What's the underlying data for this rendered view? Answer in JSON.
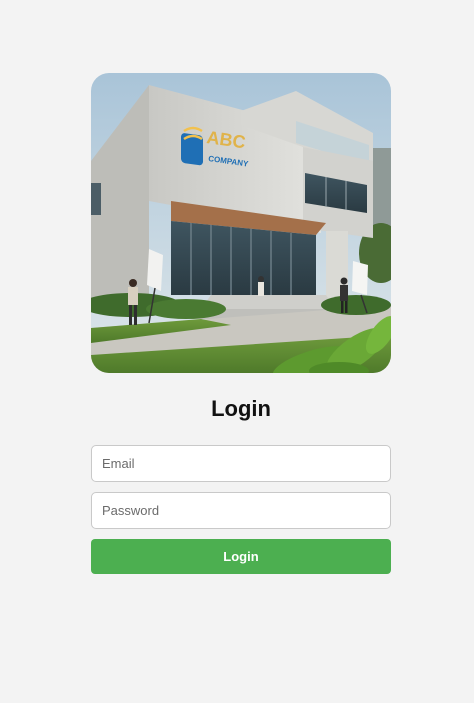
{
  "hero": {
    "logo_text": "ABC",
    "logo_subtext": "COMPANY"
  },
  "login": {
    "title": "Login",
    "email_placeholder": "Email",
    "email_value": "",
    "password_placeholder": "Password",
    "password_value": "",
    "submit_label": "Login"
  },
  "colors": {
    "background": "#f3f3f3",
    "button": "#4caf50",
    "button_text": "#ffffff",
    "field_border": "#c9c9c9"
  }
}
